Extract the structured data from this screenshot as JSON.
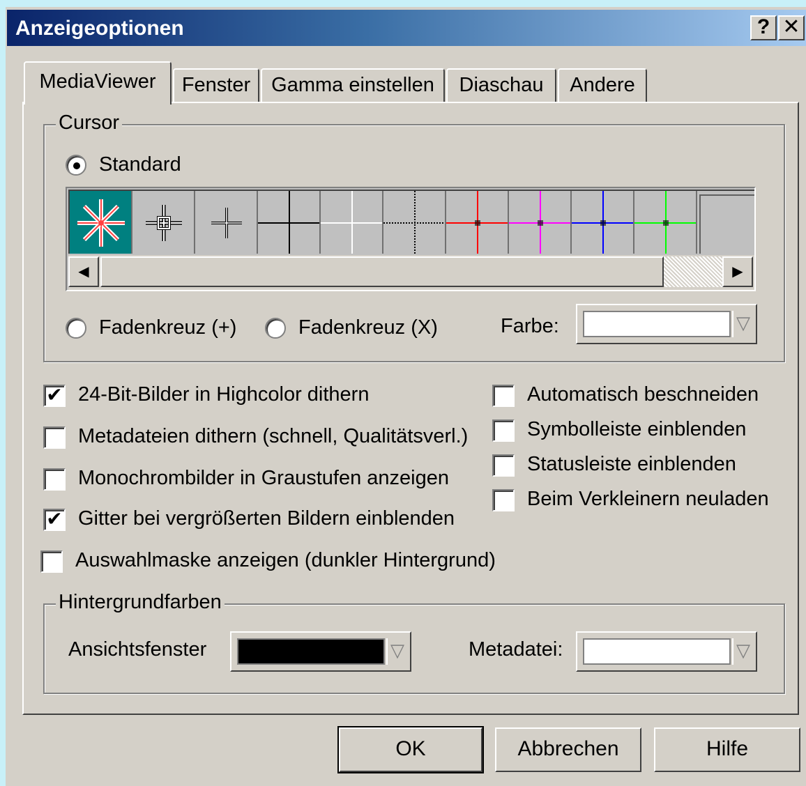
{
  "window": {
    "title": "Anzeigeoptionen",
    "help_button": "?",
    "close_button": "✕"
  },
  "tabs": [
    {
      "label": "MediaViewer",
      "active": true
    },
    {
      "label": "Fenster",
      "active": false
    },
    {
      "label": "Gamma einstellen",
      "active": false
    },
    {
      "label": "Diaschau",
      "active": false
    },
    {
      "label": "Andere",
      "active": false
    }
  ],
  "cursor_group": {
    "legend": "Cursor",
    "standard_label": "Standard",
    "standard_selected": true,
    "crosshair_plus_label": "Fadenkreuz (+)",
    "crosshair_x_label": "Fadenkreuz (X)",
    "color_label": "Farbe:",
    "color_value": "#ffffff",
    "cursor_styles": [
      {
        "icon": "star-cursor-icon",
        "color": "#ff4040",
        "selected": true
      },
      {
        "icon": "crosshair-box-cursor-icon",
        "color": "#ffffff"
      },
      {
        "icon": "small-crosshair-cursor-icon",
        "color": "#ffffff"
      },
      {
        "icon": "black-crosshair-icon",
        "color": "#000000"
      },
      {
        "icon": "white-crosshair-icon",
        "color": "#ffffff"
      },
      {
        "icon": "dotted-crosshair-icon",
        "color": "#000000"
      },
      {
        "icon": "red-crosshair-icon",
        "color": "#ff0000"
      },
      {
        "icon": "magenta-crosshair-icon",
        "color": "#ff00ff"
      },
      {
        "icon": "blue-crosshair-icon",
        "color": "#0000ff"
      },
      {
        "icon": "green-crosshair-icon",
        "color": "#00ff00"
      },
      {
        "icon": "box-cursor-icon",
        "color": "#606060"
      }
    ]
  },
  "options_left": [
    {
      "label": "24-Bit-Bilder in Highcolor dithern",
      "checked": true
    },
    {
      "label": "Metadateien dithern (schnell, Qualitätsverl.)",
      "checked": false
    },
    {
      "label": "Monochrombilder in Graustufen anzeigen",
      "checked": false
    },
    {
      "label": "Gitter bei vergrößerten Bildern einblenden",
      "checked": true
    },
    {
      "label": "Auswahlmaske anzeigen (dunkler Hintergrund)",
      "checked": false
    }
  ],
  "options_right": [
    {
      "label": "Automatisch beschneiden",
      "checked": false
    },
    {
      "label": "Symbolleiste einblenden",
      "checked": false
    },
    {
      "label": "Statusleiste einblenden",
      "checked": false
    },
    {
      "label": "Beim Verkleinern neuladen",
      "checked": false
    }
  ],
  "background_group": {
    "legend": "Hintergrundfarben",
    "view_label": "Ansichtsfenster",
    "view_color": "#000000",
    "meta_label": "Metadatei:",
    "meta_color": "#ffffff"
  },
  "buttons": {
    "ok": "OK",
    "cancel": "Abbrechen",
    "help": "Hilfe"
  }
}
